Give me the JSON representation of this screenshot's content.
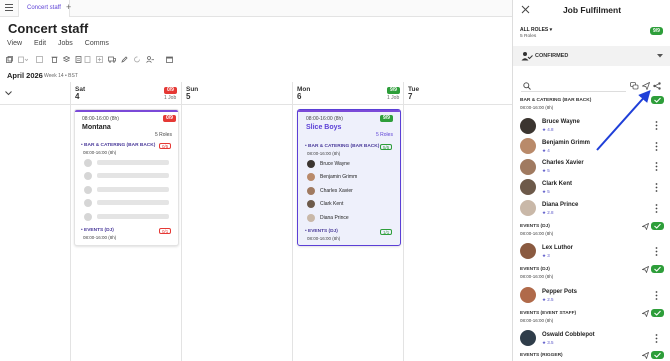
{
  "tabs": {
    "active": "Concert staff",
    "add": "+"
  },
  "page": {
    "title": "Concert staff"
  },
  "nav": [
    "View",
    "Edit",
    "Jobs",
    "Comms"
  ],
  "calendar": {
    "month": "April 2026",
    "week": "Week 14 • BST",
    "days": [
      {
        "dow": "Sat",
        "num": "4",
        "badge": "0/9",
        "badge_color": "#e53935",
        "jobs": "1 Job"
      },
      {
        "dow": "Sun",
        "num": "5",
        "badge": "",
        "badge_color": "",
        "jobs": ""
      },
      {
        "dow": "Mon",
        "num": "6",
        "badge": "9/9",
        "badge_color": "#2e9e3a",
        "jobs": "1 Job"
      },
      {
        "dow": "Tue",
        "num": "7",
        "badge": "",
        "badge_color": "",
        "jobs": ""
      }
    ]
  },
  "card_montana": {
    "time": "08:00-16:00 (8h)",
    "badge": "0/9",
    "name": "Montana",
    "roles": "5 Roles",
    "role1": "• BAR & CATERING (BAR BACK)",
    "role1_count": "0/5",
    "role1_time": "08:00-16:00 (8h)",
    "role2": "• EVENTS (DJ)",
    "role2_count": "0/1",
    "role2_time": "08:00-16:00 (8h)"
  },
  "card_slice": {
    "time": "08:00-16:00 (8h)",
    "badge": "9/9",
    "name": "Slice Boys",
    "roles": "5 Roles",
    "role1": "• BAR & CATERING (BAR BACK)",
    "role1_count": "5/5",
    "role1_time": "08:00-16:00 (8h)",
    "people": [
      "Bruce Wayne",
      "Benjamin Grimm",
      "Charles Xavier",
      "Clark Kent",
      "Diana Prince"
    ],
    "role2": "• EVENTS (DJ)",
    "role2_count": "1/1",
    "role2_time": "08:00-16:00 (8h)"
  },
  "panel": {
    "title": "Job Fulfilment",
    "all_roles": "ALL ROLES",
    "roles_count": "5 Roles",
    "badge": "9/9",
    "confirmed": "CONFIRMED",
    "sections": [
      {
        "title": "BAR & CATERING (BAR BACK)",
        "time": "08:00-16:00 (8h)"
      },
      {
        "title": "EVENTS (DJ)",
        "time": "08:00-16:00 (8h)"
      },
      {
        "title": "EVENTS (DJ)",
        "time": "08:00-16:00 (8h)"
      },
      {
        "title": "EVENTS (EVENT STAFF)",
        "time": "08:00-16:00 (8h)"
      },
      {
        "title": "EVENTS (RIGGER)",
        "time": ""
      }
    ],
    "people": [
      {
        "name": "Bruce Wayne",
        "rating": "★ 4.8",
        "color": "#3b3530"
      },
      {
        "name": "Benjamin Grimm",
        "rating": "★ 4",
        "color": "#b98a6a"
      },
      {
        "name": "Charles Xavier",
        "rating": "★ 5",
        "color": "#a07a60"
      },
      {
        "name": "Clark Kent",
        "rating": "★ 5",
        "color": "#6d5a4a"
      },
      {
        "name": "Diana Prince",
        "rating": "★ 2.8",
        "color": "#c9b8a8"
      },
      {
        "name": "Lex Luthor",
        "rating": "★ 3",
        "color": "#8a5a40"
      },
      {
        "name": "Pepper Pots",
        "rating": "★ 2.5",
        "color": "#b06a4a"
      },
      {
        "name": "Oswald Cobblepot",
        "rating": "★ 3.5",
        "color": "#2f3d4a"
      }
    ]
  },
  "colors": {
    "accent": "#5b3fd6",
    "confirmed": "#2e9e3a",
    "warning": "#e53935",
    "arrow": "#1f3fd8"
  }
}
